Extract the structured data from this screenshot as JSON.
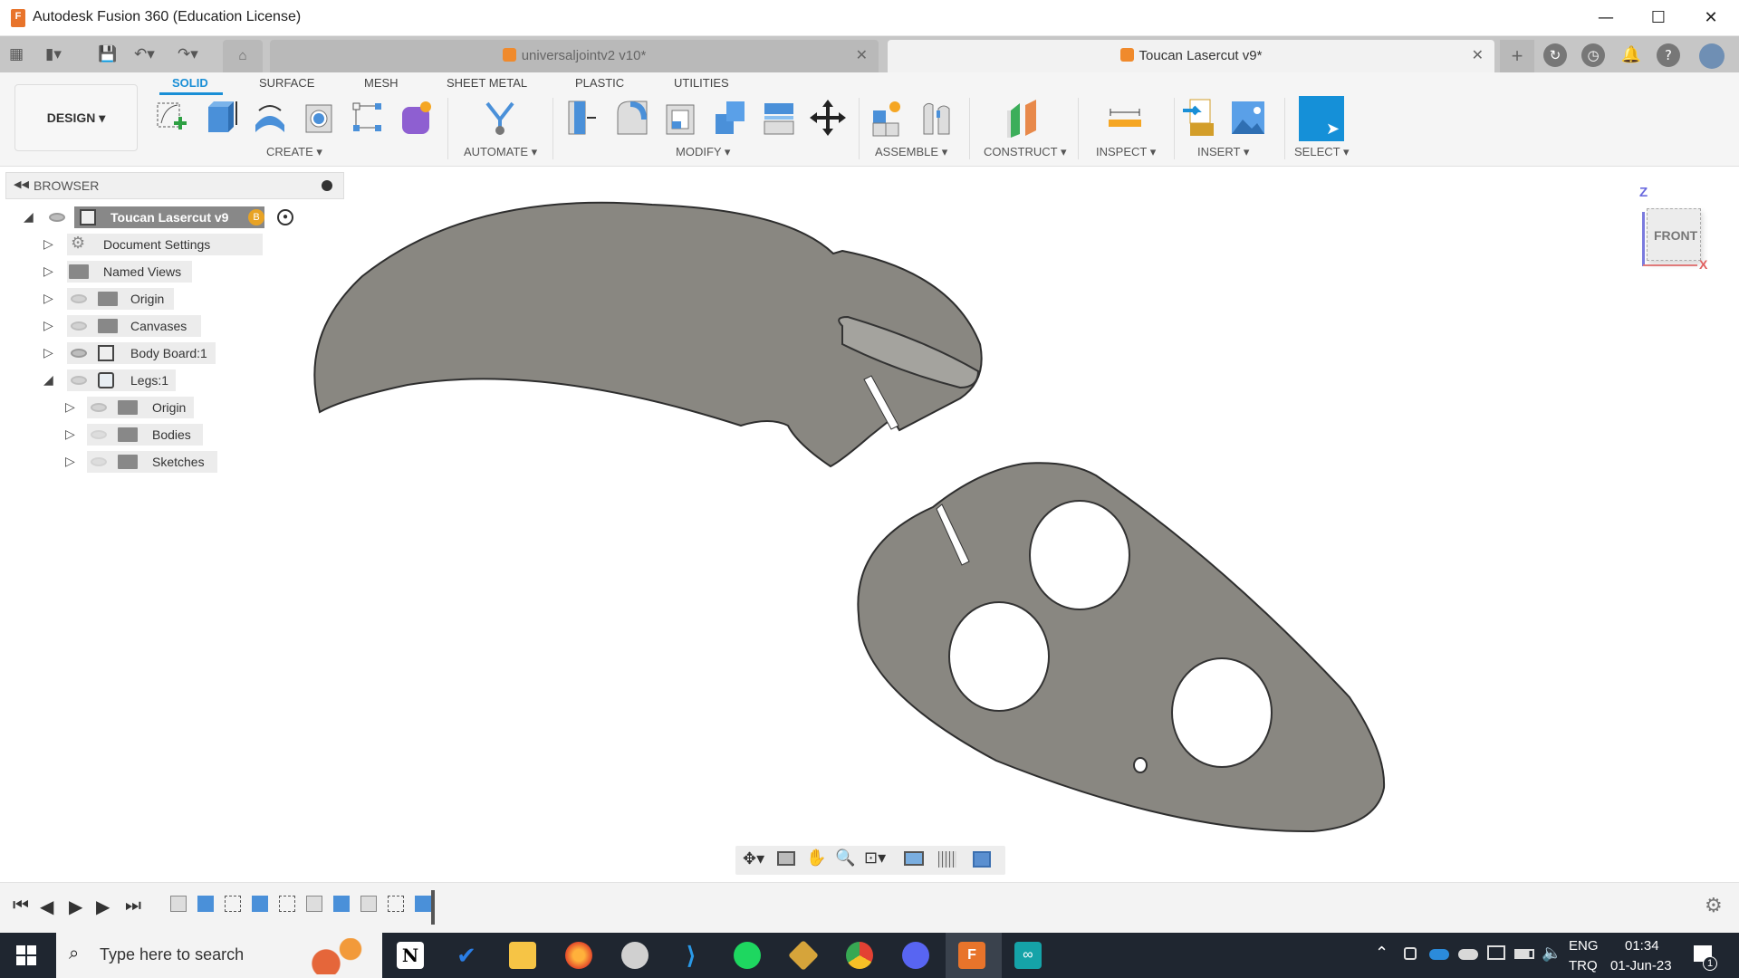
{
  "window": {
    "title": "Autodesk Fusion 360 (Education License)",
    "controls": {
      "minimize": "—",
      "maximize": "☐",
      "close": "✕"
    }
  },
  "quick_access": {
    "grid_icon": "app-grid-icon",
    "file_icon": "file-icon",
    "save_icon": "save-icon",
    "undo_icon": "undo-icon",
    "redo_icon": "redo-icon",
    "home_icon": "home-icon"
  },
  "tabs": [
    {
      "label": "universaljointv2 v10*",
      "active": false
    },
    {
      "label": "Toucan Lasercut v9*",
      "active": true
    }
  ],
  "header_right_icons": [
    "new-tab-icon",
    "extensions-icon",
    "job-status-icon",
    "notifications-icon",
    "help-icon",
    "user-avatar"
  ],
  "workspace": {
    "label": "DESIGN ▾"
  },
  "ribbon_tabs": [
    {
      "label": "SOLID",
      "selected": true
    },
    {
      "label": "SURFACE"
    },
    {
      "label": "MESH"
    },
    {
      "label": "SHEET METAL"
    },
    {
      "label": "PLASTIC"
    },
    {
      "label": "UTILITIES"
    }
  ],
  "tool_groups": [
    {
      "label": "CREATE ▾",
      "tools": [
        "create-sketch",
        "extrude",
        "revolve",
        "hole",
        "pattern",
        "create-form"
      ]
    },
    {
      "label": "AUTOMATE ▾",
      "tools": [
        "automated-modeling"
      ]
    },
    {
      "label": "MODIFY ▾",
      "tools": [
        "press-pull",
        "fillet",
        "shell",
        "combine",
        "offset-face",
        "move-copy"
      ]
    },
    {
      "label": "ASSEMBLE ▾",
      "tools": [
        "new-component",
        "joint"
      ]
    },
    {
      "label": "CONSTRUCT ▾",
      "tools": [
        "offset-plane"
      ]
    },
    {
      "label": "INSPECT ▾",
      "tools": [
        "measure"
      ]
    },
    {
      "label": "INSERT ▾",
      "tools": [
        "insert-svg",
        "canvas"
      ]
    },
    {
      "label": "SELECT ▾",
      "tools": [
        "select"
      ]
    }
  ],
  "browser": {
    "title": "BROWSER",
    "root": {
      "label": "Toucan Lasercut v9",
      "badge": "B"
    },
    "items": [
      {
        "label": "Document Settings",
        "icon": "gear-icon",
        "eye": "none",
        "expanded": false,
        "level": 1
      },
      {
        "label": "Named Views",
        "icon": "folder-icon",
        "eye": "none",
        "expanded": false,
        "level": 1
      },
      {
        "label": "Origin",
        "icon": "folder-icon",
        "eye": "hidden",
        "expanded": false,
        "level": 1
      },
      {
        "label": "Canvases",
        "icon": "folder-icon",
        "eye": "hidden",
        "expanded": false,
        "level": 1
      },
      {
        "label": "Body Board:1",
        "icon": "component-icon",
        "eye": "visible",
        "expanded": false,
        "level": 1
      },
      {
        "label": "Legs:1",
        "icon": "body-icon",
        "eye": "hidden",
        "expanded": true,
        "level": 1
      },
      {
        "label": "Origin",
        "icon": "folder-icon",
        "eye": "hidden",
        "expanded": false,
        "level": 2
      },
      {
        "label": "Bodies",
        "icon": "folder-icon",
        "eye": "faint",
        "expanded": false,
        "level": 2
      },
      {
        "label": "Sketches",
        "icon": "folder-icon",
        "eye": "faint",
        "expanded": false,
        "level": 2
      }
    ]
  },
  "viewcube": {
    "face": "FRONT",
    "axis_z": "Z",
    "axis_x": "X"
  },
  "nav_bar": [
    "orbit-icon",
    "look-at-icon",
    "pan-icon",
    "zoom-icon",
    "fit-icon",
    "display-settings-icon",
    "grid-icon",
    "viewports-icon"
  ],
  "timeline": {
    "controls": [
      "first-icon",
      "previous-icon",
      "play-icon",
      "next-icon",
      "last-icon"
    ],
    "features": [
      "component",
      "canvas",
      "sketch",
      "extrude",
      "sketch",
      "component",
      "extrude",
      "component",
      "sketch",
      "extrude"
    ]
  },
  "taskbar": {
    "search_placeholder": "Type here to search",
    "apps": [
      "notion",
      "todo",
      "file-explorer",
      "firefox",
      "snip-sketch",
      "vscode",
      "spotify",
      "git",
      "chrome",
      "discord",
      "fusion-360",
      "arduino"
    ],
    "lang_top": "ENG",
    "lang_bottom": "TRQ",
    "time": "01:34",
    "date": "01-Jun-23",
    "notification_count": "1"
  },
  "colors": {
    "accent": "#1a8fd6",
    "model_gray": "#898781",
    "fusion_orange": "#f08a2c"
  }
}
